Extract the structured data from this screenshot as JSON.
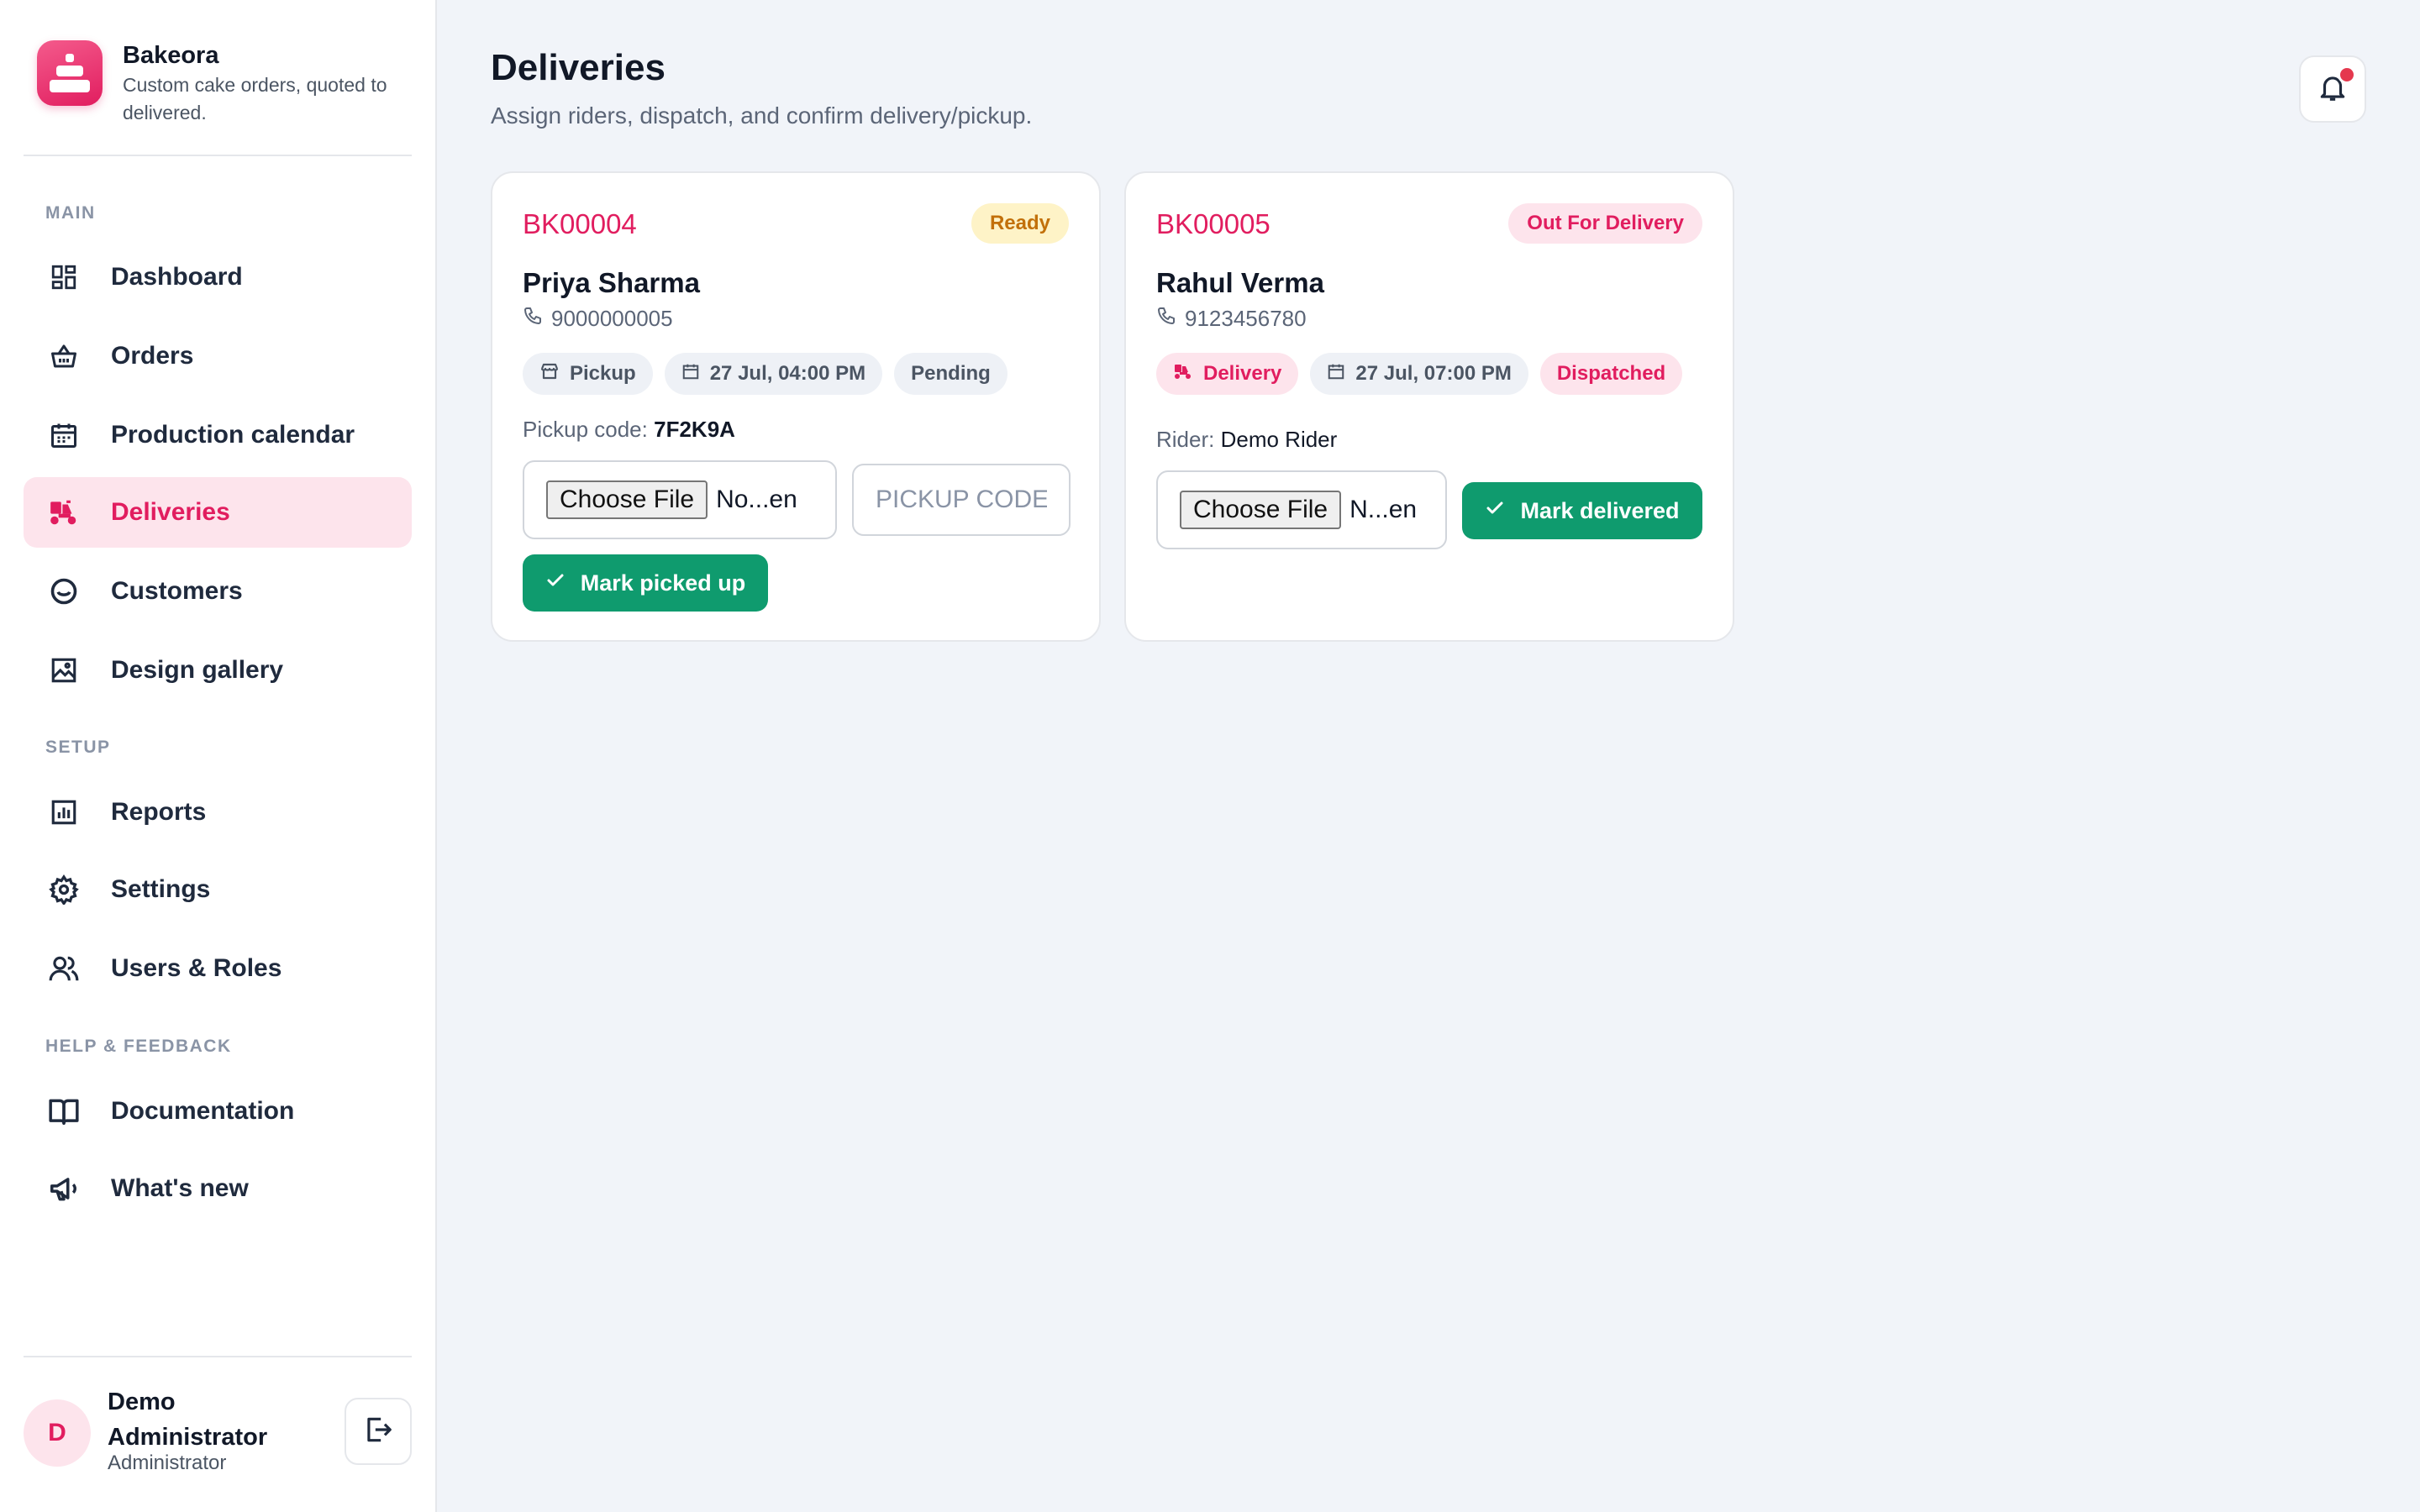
{
  "app": {
    "name": "Bakeora",
    "tagline": "Custom cake orders, quoted to delivered.",
    "brand_color": "#e11d5f",
    "success_color": "#0f9b6e"
  },
  "sidebar": {
    "sections": [
      {
        "label": "MAIN"
      },
      {
        "label": "SETUP"
      },
      {
        "label": "HELP & FEEDBACK"
      }
    ],
    "items": [
      {
        "label": "Dashboard",
        "icon": "dashboard-icon"
      },
      {
        "label": "Orders",
        "icon": "basket-icon"
      },
      {
        "label": "Production calendar",
        "icon": "calendar-icon"
      },
      {
        "label": "Deliveries",
        "icon": "scooter-icon",
        "active": true
      },
      {
        "label": "Customers",
        "icon": "smile-icon"
      },
      {
        "label": "Design gallery",
        "icon": "image-icon"
      },
      {
        "label": "Reports",
        "icon": "bar-chart-icon"
      },
      {
        "label": "Settings",
        "icon": "gear-icon"
      },
      {
        "label": "Users & Roles",
        "icon": "users-icon"
      },
      {
        "label": "Documentation",
        "icon": "book-icon"
      },
      {
        "label": "What's new",
        "icon": "megaphone-icon"
      }
    ],
    "user": {
      "initial": "D",
      "name": "Demo Administrator",
      "role": "Administrator"
    }
  },
  "header": {
    "title": "Deliveries",
    "subtitle": "Assign riders, dispatch, and confirm delivery/pickup."
  },
  "cards": [
    {
      "order_id": "BK00004",
      "status": "Ready",
      "customer": "Priya Sharma",
      "phone": "9000000005",
      "chips": [
        "Pickup",
        "27 Jul, 04:00 PM",
        "Pending"
      ],
      "meta_label": "Pickup code:",
      "meta_value": "7F2K9A",
      "file_button": "Choose File",
      "file_name": "No...en",
      "code_placeholder": "PICKUP CODE",
      "action": "Mark picked up"
    },
    {
      "order_id": "BK00005",
      "status": "Out For Delivery",
      "customer": "Rahul Verma",
      "phone": "9123456780",
      "chips": [
        "Delivery",
        "27 Jul, 07:00 PM",
        "Dispatched"
      ],
      "meta_label": "Rider:",
      "meta_value": "Demo Rider",
      "file_button": "Choose File",
      "file_name": "N...en",
      "action": "Mark delivered"
    }
  ]
}
